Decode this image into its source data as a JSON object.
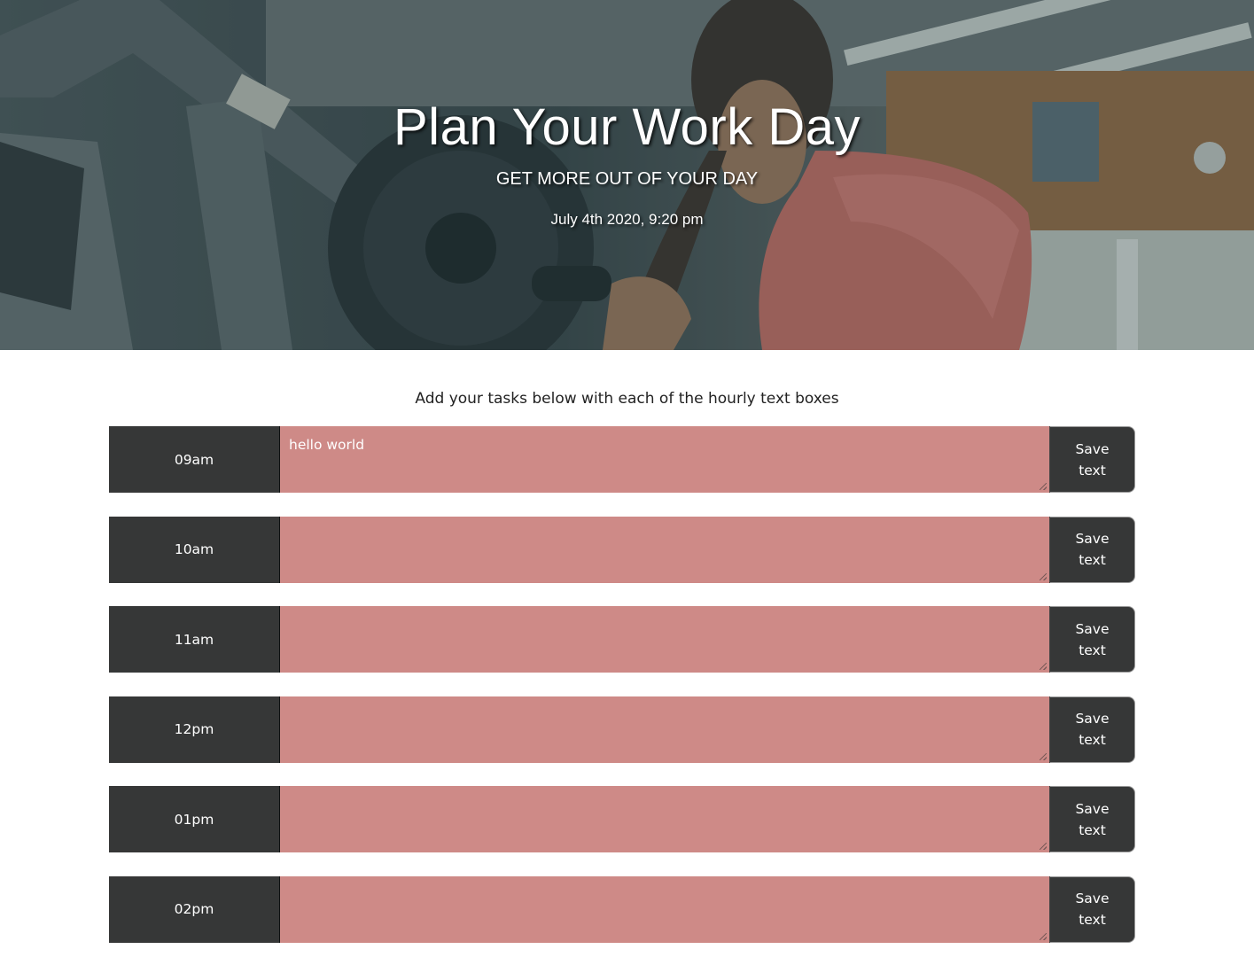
{
  "header": {
    "title": "Plan Your Work Day",
    "subtitle": "GET MORE OUT OF YOUR DAY",
    "datetime": "July 4th 2020, 9:20 pm"
  },
  "main": {
    "intro": "Add your tasks below with each of the hourly text boxes",
    "rows": [
      {
        "hour": "09am",
        "task": "hello world",
        "save_label": "Save text"
      },
      {
        "hour": "10am",
        "task": "",
        "save_label": "Save text"
      },
      {
        "hour": "11am",
        "task": "",
        "save_label": "Save text"
      },
      {
        "hour": "12pm",
        "task": "",
        "save_label": "Save text"
      },
      {
        "hour": "01pm",
        "task": "",
        "save_label": "Save text"
      },
      {
        "hour": "02pm",
        "task": "",
        "save_label": "Save text"
      }
    ]
  },
  "colors": {
    "hour_block": "#363737",
    "task_past": "#ce8a87",
    "text": "#ffffff"
  }
}
